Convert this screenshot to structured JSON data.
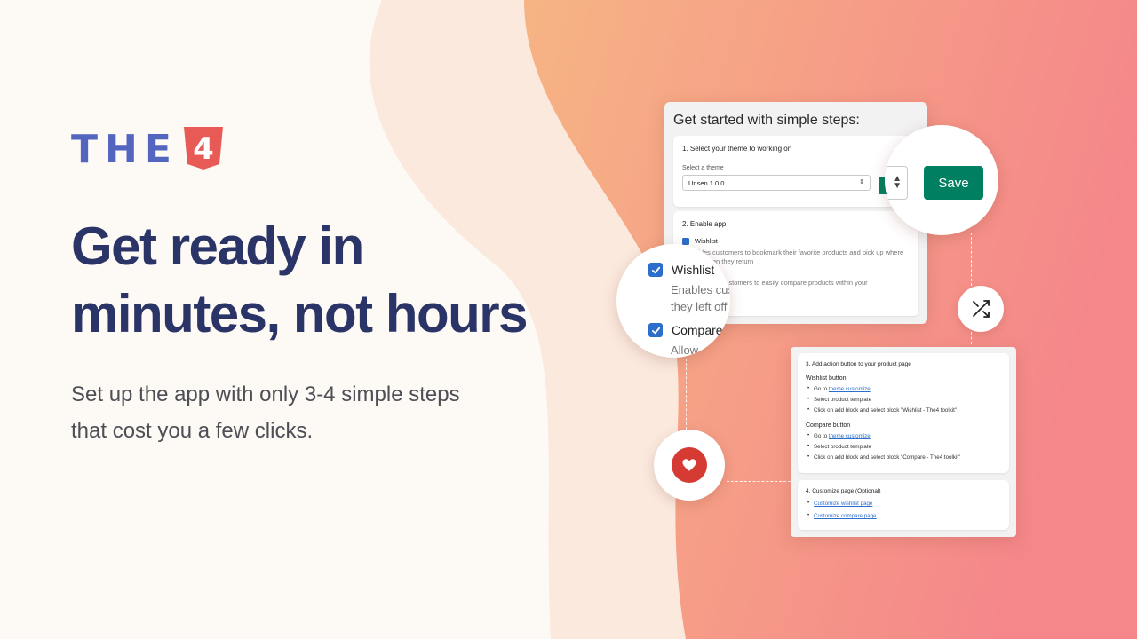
{
  "brand": {
    "logo_text": "THE",
    "logo_badge": "4"
  },
  "hero": {
    "headline_line1": "Get ready in",
    "headline_line2": "minutes, not hours",
    "subtext_line1": "Set up the app with only 3-4 simple steps",
    "subtext_line2": "that cost you a few clicks."
  },
  "card_main": {
    "title": "Get started with simple steps:",
    "step1": {
      "title": "1. Select your theme to working on",
      "label": "Select a theme",
      "selected": "Unsen 1.0.0"
    },
    "step2": {
      "title": "2. Enable app",
      "wishlist_label": "Wishlist",
      "wishlist_desc_line1": "ables customers to bookmark their favorite products and pick up where",
      "wishlist_desc_line2": "off when they return",
      "compare_desc": "potential customers to easily compare products within your"
    }
  },
  "zoom_save": {
    "button_label": "Save"
  },
  "zoom_wishlist": {
    "wishlist_label": "Wishlist",
    "wishlist_desc_line1": "Enables cus",
    "wishlist_desc_line2": "they left off",
    "compare_label": "Compare",
    "compare_desc": "Allow"
  },
  "card_two": {
    "step3": {
      "title": "3. Add action button to your product page",
      "wishlist_heading": "Wishlist button",
      "wishlist_items": {
        "goto_prefix": "Go to",
        "goto_link": "theme customize",
        "item2": "Select product template",
        "item3": "Click on add block and select block \"Wishlist - The4 toolkit\""
      },
      "compare_heading": "Compare button",
      "compare_items": {
        "goto_prefix": "Go to",
        "goto_link": "theme customize",
        "item2": "Select product template",
        "item3": "Click on add block and select block \"Compare - The4 toolkit\""
      }
    },
    "step4": {
      "title": "4. Customize page (Optional)",
      "link1": "Customize wishlist page",
      "link2": "Customize compare page"
    }
  },
  "colors": {
    "brand_blue": "#5465c0",
    "brand_red": "#e85a55",
    "headline": "#2a3466",
    "save_green": "#008060",
    "check_blue": "#2c6ecb",
    "heart_red": "#d53a33",
    "gradient_start": "#f6b484",
    "gradient_end": "#f5868a"
  },
  "icons": {
    "shuffle": "shuffle-icon",
    "heart": "heart-icon",
    "check": "check-icon"
  }
}
